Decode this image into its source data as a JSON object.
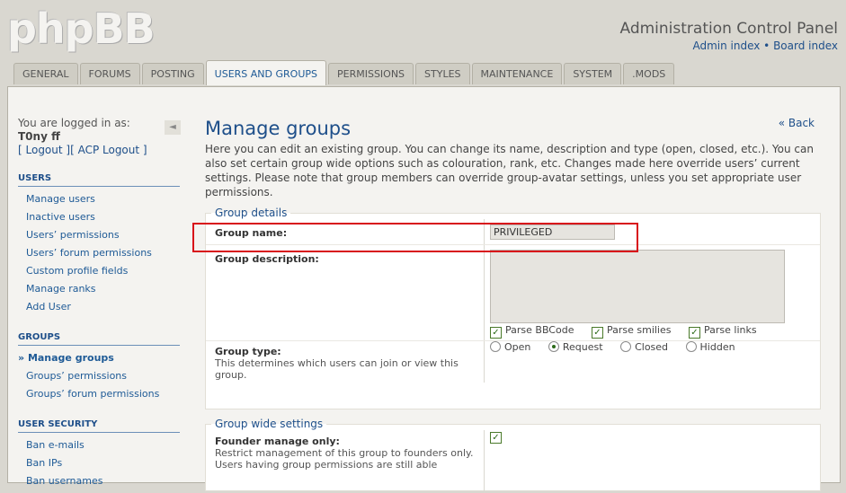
{
  "header": {
    "logo": "phpBB",
    "title": "Administration Control Panel",
    "link_admin": "Admin index",
    "sep": "•",
    "link_board": "Board index"
  },
  "tabs": [
    "GENERAL",
    "FORUMS",
    "POSTING",
    "USERS AND GROUPS",
    "PERMISSIONS",
    "STYLES",
    "MAINTENANCE",
    "SYSTEM",
    ".MODS"
  ],
  "sidebar": {
    "logged_in": "You are logged in as:",
    "username": "T0ny ff",
    "logout": "[ Logout ][ ACP Logout ]",
    "collapse_icon": "◄",
    "sections": [
      {
        "title": "USERS",
        "items": [
          "Manage users",
          "Inactive users",
          "Users’ permissions",
          "Users’ forum permissions",
          "Custom profile fields",
          "Manage ranks",
          "Add User"
        ]
      },
      {
        "title": "GROUPS",
        "items": [
          "Manage groups",
          "Groups’ permissions",
          "Groups’ forum permissions"
        ]
      },
      {
        "title": "USER SECURITY",
        "items": [
          "Ban e-mails",
          "Ban IPs",
          "Ban usernames"
        ]
      }
    ]
  },
  "main": {
    "back": "« Back",
    "title": "Manage groups",
    "intro": "Here you can edit an existing group. You can change its name, description and type (open, closed, etc.). You can also set certain group wide options such as colouration, rank, etc. Changes made here override users’ current settings. Please note that group members can override group-avatar settings, unless you set appropriate user permissions.",
    "group_details": {
      "legend": "Group details",
      "name_label": "Group name:",
      "name_value": "PRIVILEGED",
      "desc_label": "Group description:",
      "parse_bbcode": "Parse BBCode",
      "parse_smilies": "Parse smilies",
      "parse_links": "Parse links",
      "type_label": "Group type:",
      "type_explain": "This determines which users can join or view this group.",
      "type_open": "Open",
      "type_request": "Request",
      "type_closed": "Closed",
      "type_hidden": "Hidden",
      "selected_type": "Request"
    },
    "group_wide": {
      "legend": "Group wide settings",
      "founder_label": "Founder manage only:",
      "founder_explain": "Restrict management of this group to founders only. Users having group permissions are still able"
    }
  },
  "colors": {
    "accent": "#1e4f8a",
    "highlight": "#d8101a"
  }
}
